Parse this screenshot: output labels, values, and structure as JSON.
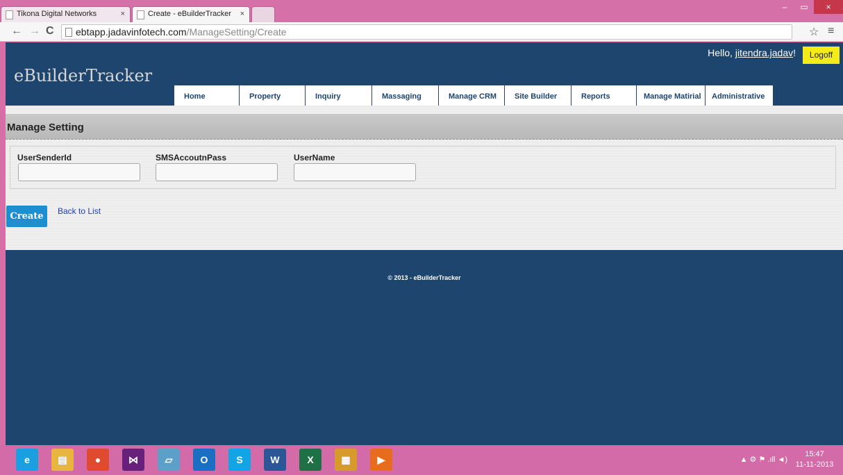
{
  "browser": {
    "tabs": [
      {
        "title": "Tikona Digital Networks",
        "close": "×"
      },
      {
        "title": "Create - eBuilderTracker",
        "close": "×"
      }
    ],
    "window_controls": {
      "minimize": "–",
      "maximize": "▭",
      "close": "×"
    },
    "nav": {
      "back": "←",
      "forward": "→",
      "reload": "C",
      "star": "☆",
      "menu": "≡"
    },
    "url_host": "ebtapp.jadavinfotech.com",
    "url_path": "/ManageSetting/Create"
  },
  "site": {
    "logo": "eBuilderTracker",
    "greeting_prefix": "Hello, ",
    "user": "jitendra.jadav",
    "greeting_suffix": "!",
    "logoff": "Logoff",
    "menu": [
      "Home",
      "Property",
      "Inquiry",
      "Massaging",
      "Manage CRM",
      "Site Builder",
      "Reports",
      "Manage Matirial",
      "Administrative"
    ]
  },
  "page": {
    "title": "Manage Setting",
    "fields": [
      {
        "label": "UserSenderId",
        "value": ""
      },
      {
        "label": "SMSAccoutnPass",
        "value": ""
      },
      {
        "label": "UserName",
        "value": ""
      }
    ],
    "create_button": "Create",
    "back_link": "Back to List"
  },
  "footer": {
    "copyright": "© 2013 - eBuilderTracker"
  },
  "taskbar": {
    "apps": [
      {
        "icon": "internet-explorer-icon",
        "glyph": "e",
        "color": "#1a9fe0"
      },
      {
        "icon": "file-explorer-icon",
        "glyph": "▤",
        "color": "#e8b640"
      },
      {
        "icon": "chrome-icon",
        "glyph": "●",
        "color": "#e04a2f"
      },
      {
        "icon": "visual-studio-icon",
        "glyph": "⋈",
        "color": "#68217a"
      },
      {
        "icon": "notepad-icon",
        "glyph": "▱",
        "color": "#5aa0c8"
      },
      {
        "icon": "outlook-icon",
        "glyph": "O",
        "color": "#1a6fc2"
      },
      {
        "icon": "skype-icon",
        "glyph": "S",
        "color": "#12a5e6"
      },
      {
        "icon": "word-icon",
        "glyph": "W",
        "color": "#2b5797"
      },
      {
        "icon": "excel-icon",
        "glyph": "X",
        "color": "#1e7145"
      },
      {
        "icon": "paint-icon",
        "glyph": "▦",
        "color": "#d69b2a"
      },
      {
        "icon": "media-player-icon",
        "glyph": "▶",
        "color": "#e86c1e"
      }
    ],
    "tray": "▲  ⚙  ⚑  .ıll  ◄)",
    "time": "15:47",
    "date": "11-11-2013"
  }
}
